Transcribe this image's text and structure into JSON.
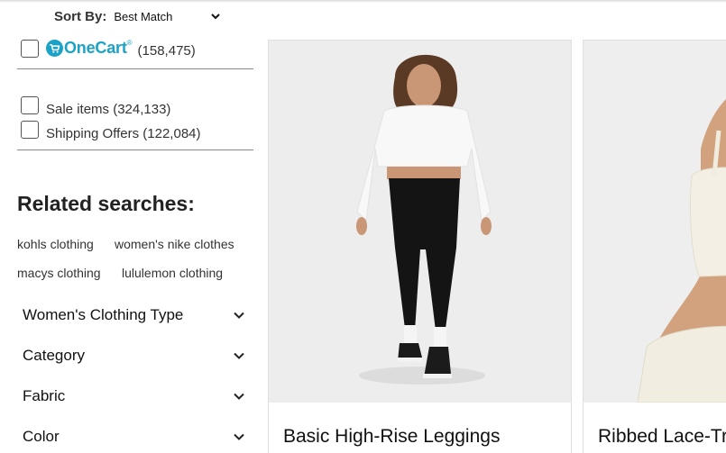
{
  "sort": {
    "label": "Sort By:",
    "value": "Best Match"
  },
  "filters": {
    "onecart": {
      "brand": "OneCart",
      "reg": "®",
      "count": "(158,475)"
    },
    "sale": "Sale items (324,133)",
    "shipping": "Shipping Offers (122,084)"
  },
  "related": {
    "title": "Related searches:",
    "links": [
      "kohls clothing",
      "women's nike clothes",
      "macys clothing",
      "lululemon clothing"
    ]
  },
  "facets": [
    "Women's Clothing Type",
    "Category",
    "Fabric",
    "Color"
  ],
  "products": [
    {
      "title": "Basic High-Rise Leggings"
    },
    {
      "title": "Ribbed Lace-Trim"
    }
  ],
  "colors": {
    "onecart_accent": "#1aa3c7",
    "divider": "#8a8a8a",
    "card_border": "#e0e0e0"
  }
}
